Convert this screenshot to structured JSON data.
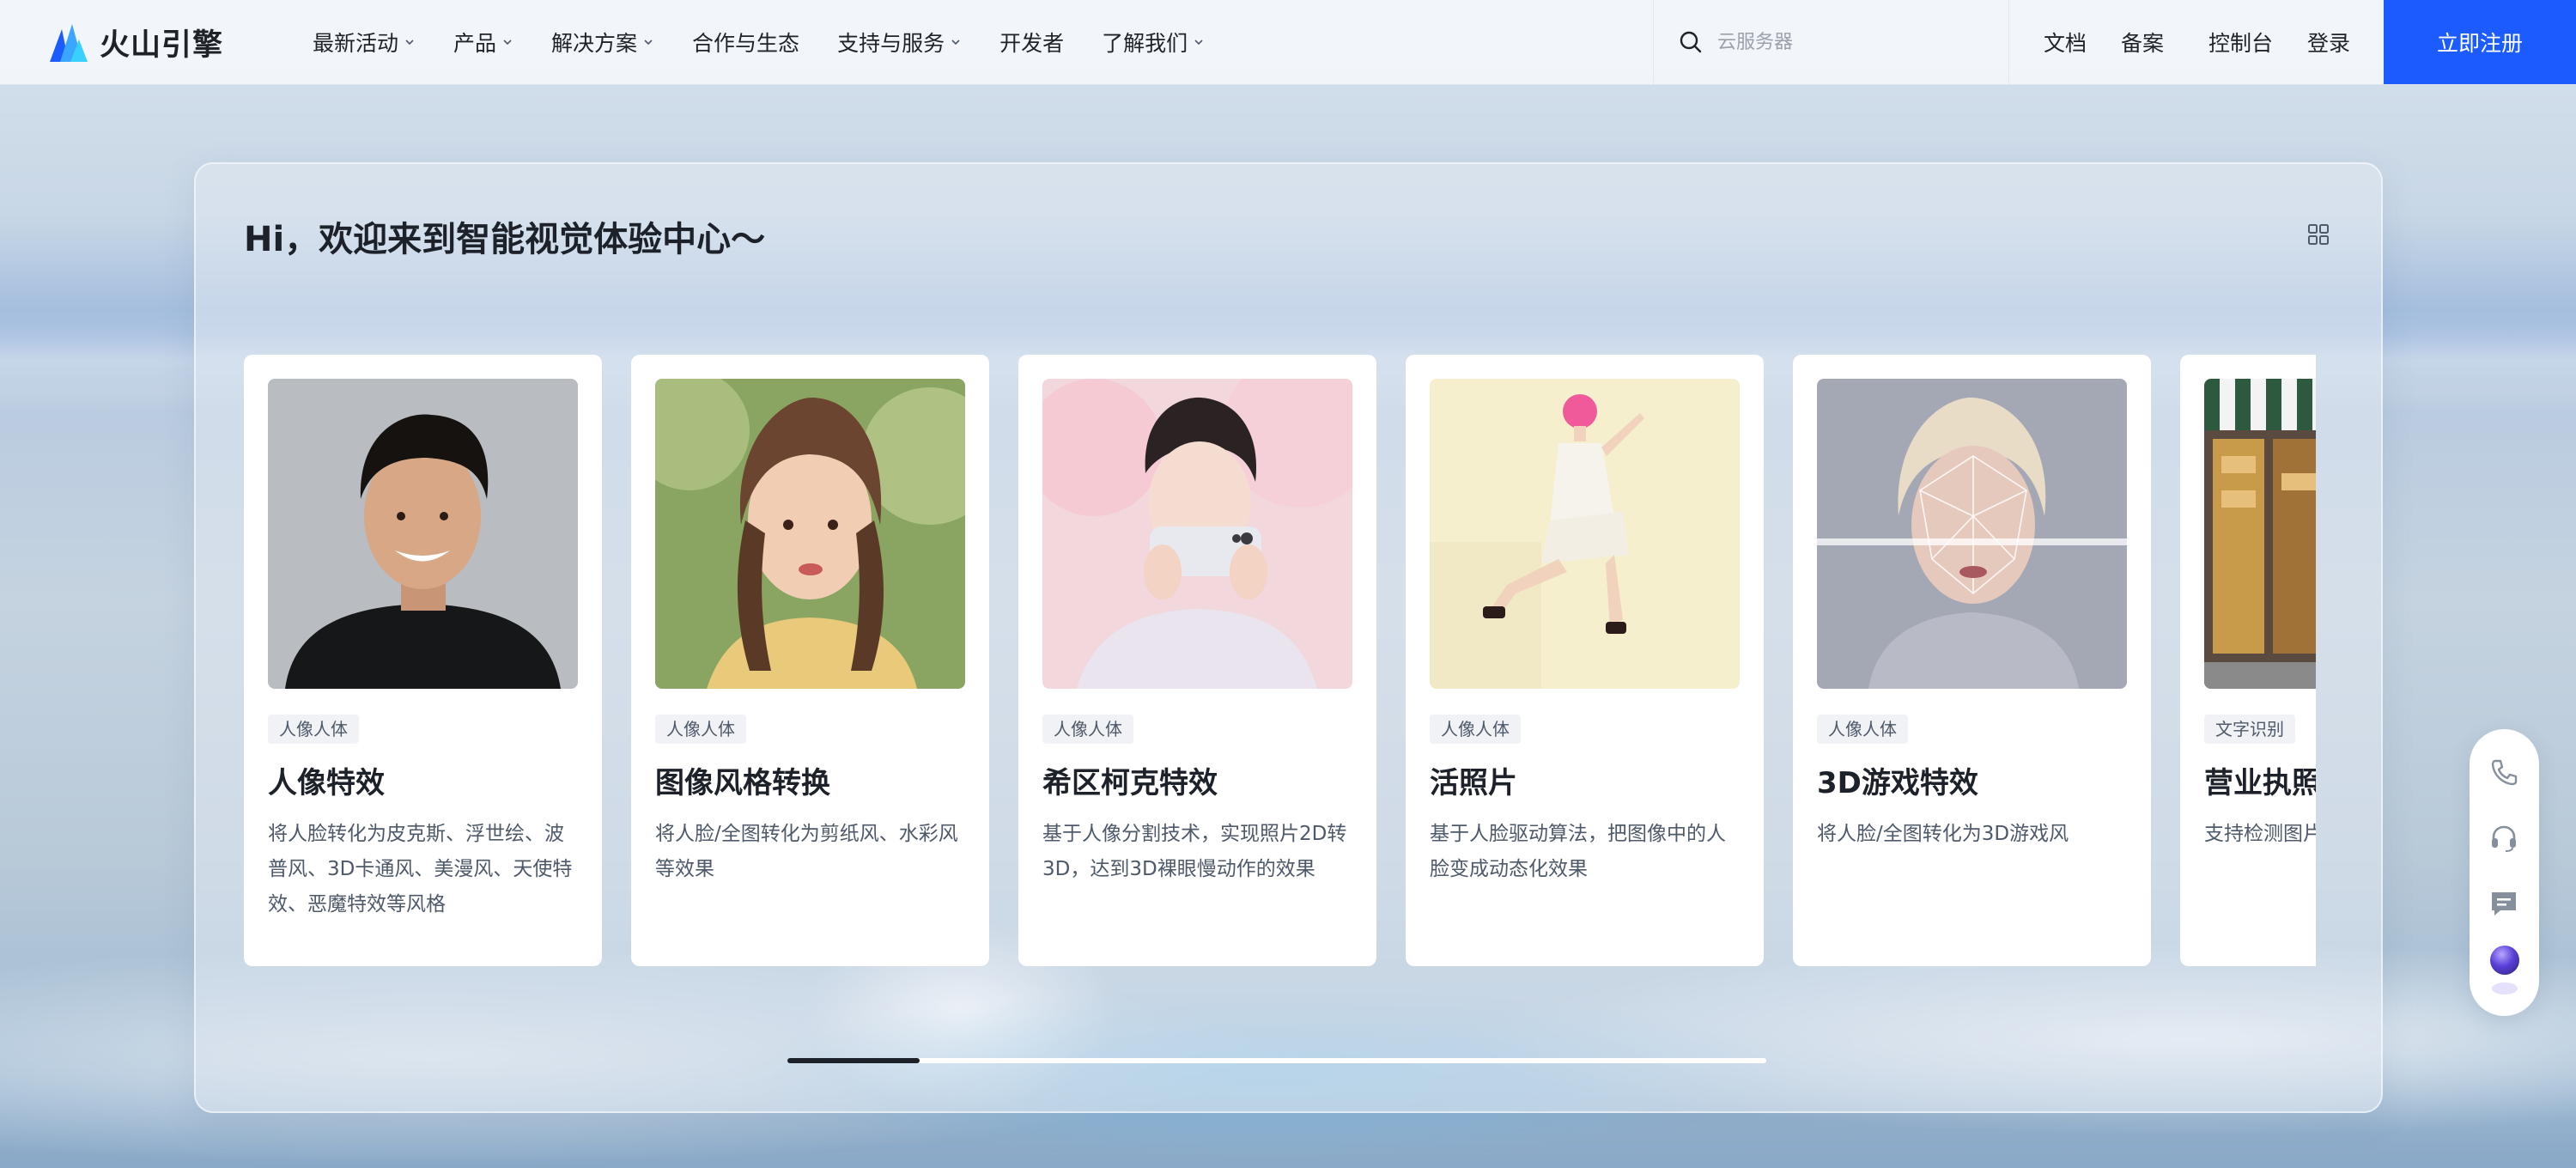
{
  "header": {
    "logo_text": "火山引擎",
    "nav": [
      {
        "label": "最新活动",
        "has_dropdown": true
      },
      {
        "label": "产品",
        "has_dropdown": true
      },
      {
        "label": "解决方案",
        "has_dropdown": true
      },
      {
        "label": "合作与生态",
        "has_dropdown": false
      },
      {
        "label": "支持与服务",
        "has_dropdown": true
      },
      {
        "label": "开发者",
        "has_dropdown": false
      },
      {
        "label": "了解我们",
        "has_dropdown": true
      }
    ],
    "search": {
      "placeholder": "云服务器",
      "icon": "search-icon"
    },
    "links": [
      "文档",
      "备案",
      "控制台",
      "登录"
    ],
    "signup_label": "立即注册",
    "accent_color": "#1c5cff"
  },
  "main": {
    "title": "Hi，欢迎来到智能视觉体验中心～",
    "view_toggle_icon": "grid-icon",
    "scroll_progress": 0.135,
    "cards": [
      {
        "tag": "人像人体",
        "title": "人像特效",
        "desc": "将人脸转化为皮克斯、浮世绘、波普风、3D卡通风、美漫风、天使特效、恶魔特效等风格"
      },
      {
        "tag": "人像人体",
        "title": "图像风格转换",
        "desc": "将人脸/全图转化为剪纸风、水彩风等效果"
      },
      {
        "tag": "人像人体",
        "title": "希区柯克特效",
        "desc": "基于人像分割技术，实现照片2D转3D，达到3D裸眼慢动作的效果"
      },
      {
        "tag": "人像人体",
        "title": "活照片",
        "desc": "基于人脸驱动算法，把图像中的人脸变成动态化效果"
      },
      {
        "tag": "人像人体",
        "title": "3D游戏特效",
        "desc": "将人脸/全图转化为3D游戏风"
      },
      {
        "tag": "文字识别",
        "title": "营业执照",
        "desc": "支持检测图片构化输出其上"
      }
    ]
  },
  "float_toolbar": {
    "icons": [
      "phone-icon",
      "headset-icon",
      "message-icon",
      "assistant-orb-icon"
    ]
  }
}
